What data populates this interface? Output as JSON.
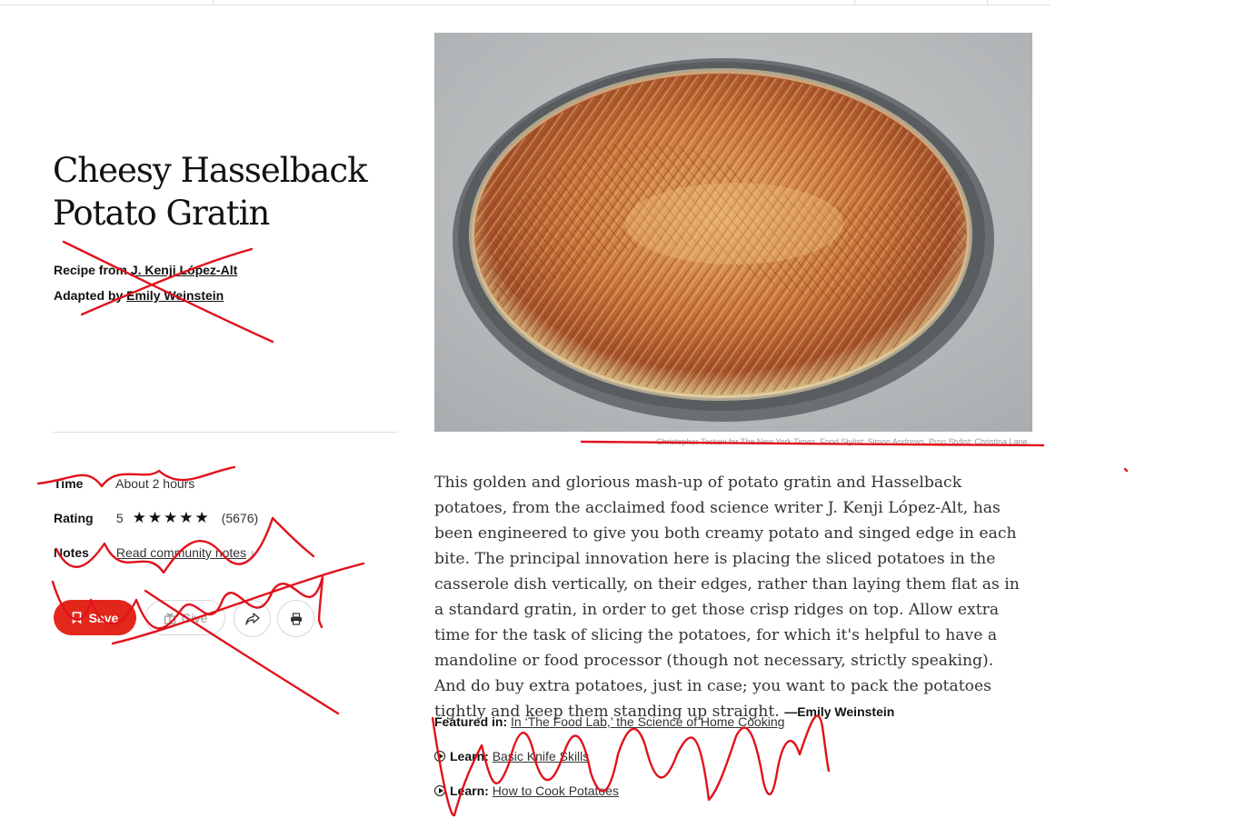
{
  "recipe": {
    "title": "Cheesy Hasselback Potato Gratin",
    "recipe_from_label": "Recipe from",
    "author": "J. Kenji López-Alt",
    "adapted_by_label": "Adapted by",
    "adapter": "Emily Weinstein"
  },
  "meta": {
    "time_label": "Time",
    "time_value": "About 2 hours",
    "rating_label": "Rating",
    "rating_value": "5",
    "rating_stars": "★★★★★",
    "rating_count": "(5676)",
    "notes_label": "Notes",
    "notes_link": "Read community notes"
  },
  "actions": {
    "save_label": "Save",
    "give_label": "Give"
  },
  "photo": {
    "credit": "Christopher Testani for The New York Times. Food Stylist: Simon Andrews. Prop Stylist: Christina Lane."
  },
  "description": {
    "body": "This golden and glorious mash-up of potato gratin and Hasselback potatoes, from the acclaimed food science writer J. Kenji López-Alt, has been engineered to give you both creamy potato and singed edge in each bite. The principal innovation here is placing the sliced potatoes in the casserole dish vertically, on their edges, rather than laying them flat as in a standard gratin, in order to get those crisp ridges on top. Allow extra time for the task of slicing the potatoes, for which it's helpful to have a mandoline or food processor (though not necessary, strictly speaking). And do buy extra potatoes, just in case; you want to pack the potatoes tightly and keep them standing up straight.",
    "signature": "—Emily Weinstein"
  },
  "featured": {
    "label": "Featured in:",
    "link": "In ‘The Food Lab,’ the Science of Home Cooking"
  },
  "learn": [
    {
      "label": "Learn:",
      "link": "Basic Knife Skills"
    },
    {
      "label": "Learn:",
      "link": "How to Cook Potatoes"
    }
  ],
  "colors": {
    "accent": "#e2281a",
    "annotation_ink": "#e0121b"
  },
  "icons": [
    "bookmark-icon",
    "gift-icon",
    "share-icon",
    "print-icon",
    "arrow-down-icon",
    "play-icon"
  ]
}
